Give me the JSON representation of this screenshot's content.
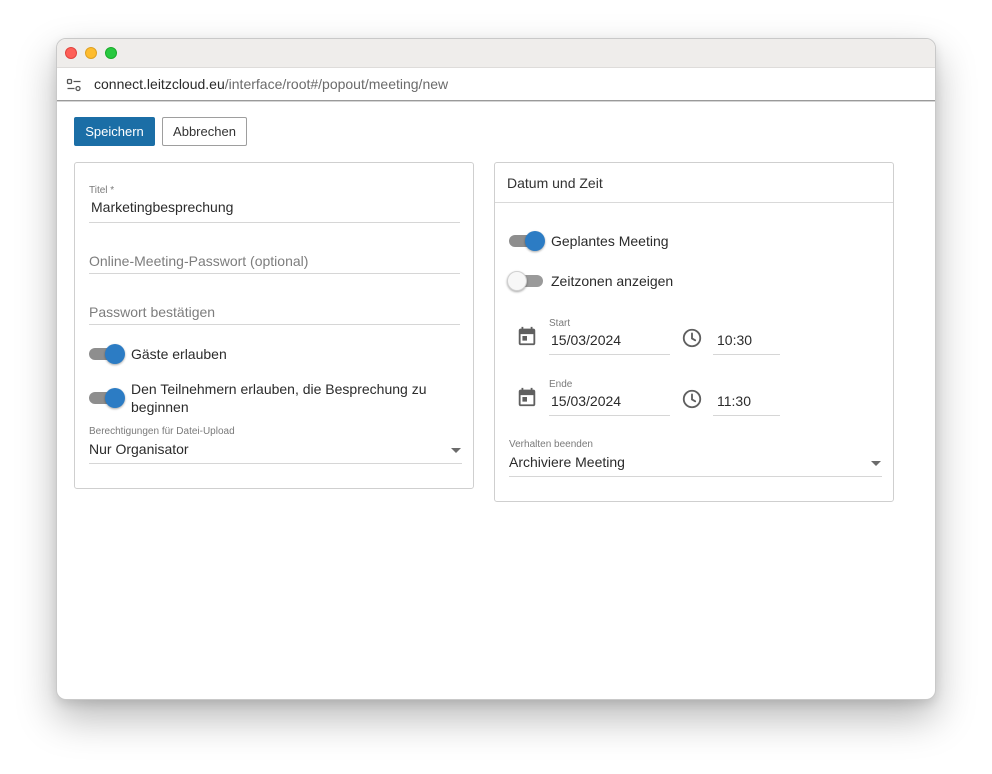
{
  "browser": {
    "url_host": "connect.leitzcloud.eu",
    "url_path": "/interface/root#/popout/meeting/new"
  },
  "toolbar": {
    "save_label": "Speichern",
    "cancel_label": "Abbrechen"
  },
  "left_card": {
    "title_label": "Titel *",
    "title_value": "Marketingbesprechung",
    "password_placeholder": "Online-Meeting-Passwort (optional)",
    "password_confirm_placeholder": "Passwort bestätigen",
    "allow_guests_label": "Gäste erlauben",
    "allow_guests_on": true,
    "allow_start_label_line1": "Den Teilnehmern erlauben, die Besprechung zu",
    "allow_start_label_line2": "beginnen",
    "allow_start_on": true,
    "upload_label": "Berechtigungen für Datei-Upload",
    "upload_value": "Nur Organisator"
  },
  "right_card": {
    "header": "Datum und Zeit",
    "scheduled_label": "Geplantes Meeting",
    "scheduled_on": true,
    "timezones_label": "Zeitzonen anzeigen",
    "timezones_on": false,
    "start_label": "Start",
    "start_date": "15/03/2024",
    "start_time": "10:30",
    "end_label": "Ende",
    "end_date": "15/03/2024",
    "end_time": "11:30",
    "end_behavior_label": "Verhalten beenden",
    "end_behavior_value": "Archiviere Meeting"
  },
  "icons": {
    "url_settings": "tune-icon",
    "date": "calendar-icon",
    "time": "clock-icon",
    "dropdown": "caret-down-icon"
  },
  "colors": {
    "primary": "#1b6ea6",
    "toggle_on": "#2c7cc4"
  }
}
